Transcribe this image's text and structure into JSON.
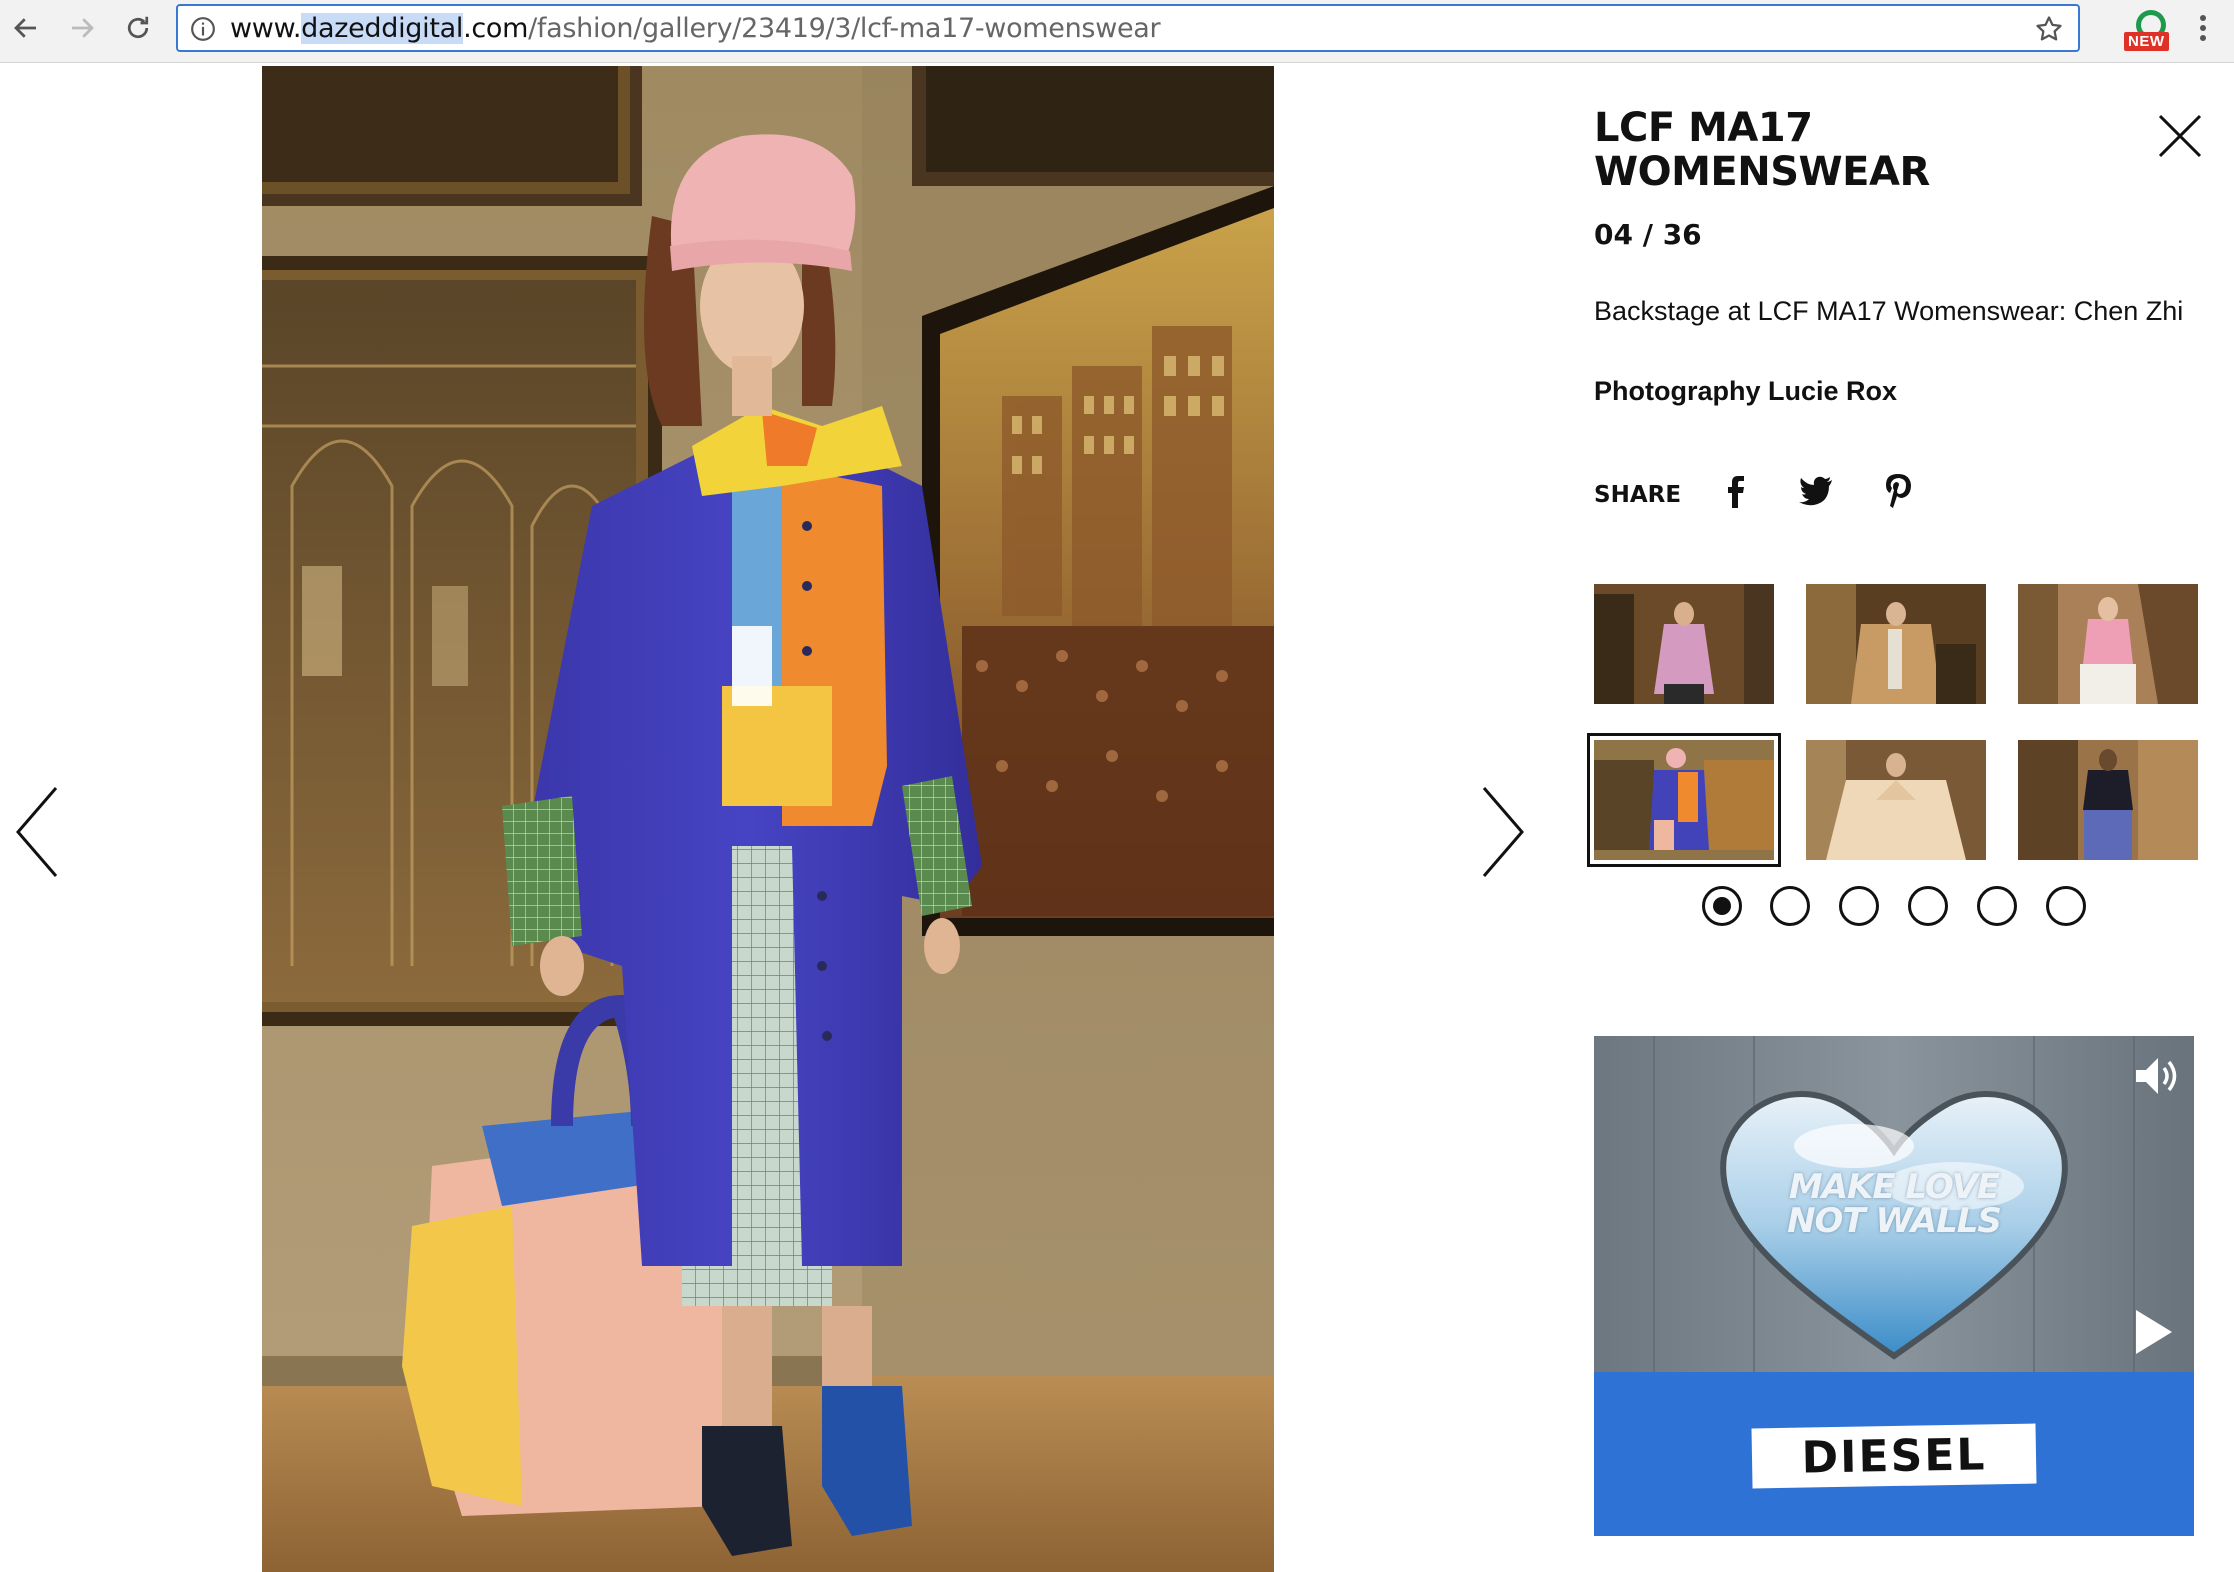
{
  "browser": {
    "url_host_prefix": "www.",
    "url_host_highlight": "dazeddigital",
    "url_host_suffix": ".com",
    "url_path": "/fashion/gallery/23419/3/lcf-ma17-womenswear",
    "extension_badge": "NEW",
    "icons": [
      "back-arrow-icon",
      "forward-arrow-icon",
      "reload-icon",
      "info-icon",
      "star-icon",
      "extension-icon",
      "menu-dots-icon"
    ]
  },
  "gallery": {
    "title": "LCF MA17 WOMENSWEAR",
    "counter": "04 / 36",
    "caption": "Backstage at LCF MA17 Womenswear: Chen Zhi",
    "credit": "Photography Lucie Rox",
    "share_label": "SHARE",
    "share_icons": [
      "facebook-icon",
      "twitter-icon",
      "pinterest-icon"
    ],
    "thumbnails_selected_index": 3,
    "pagination_dots": 6,
    "pagination_active_index": 0
  },
  "ad": {
    "tagline_line1": "MAKE LOVE",
    "tagline_line2": "NOT WALLS",
    "brand": "DIESEL"
  }
}
